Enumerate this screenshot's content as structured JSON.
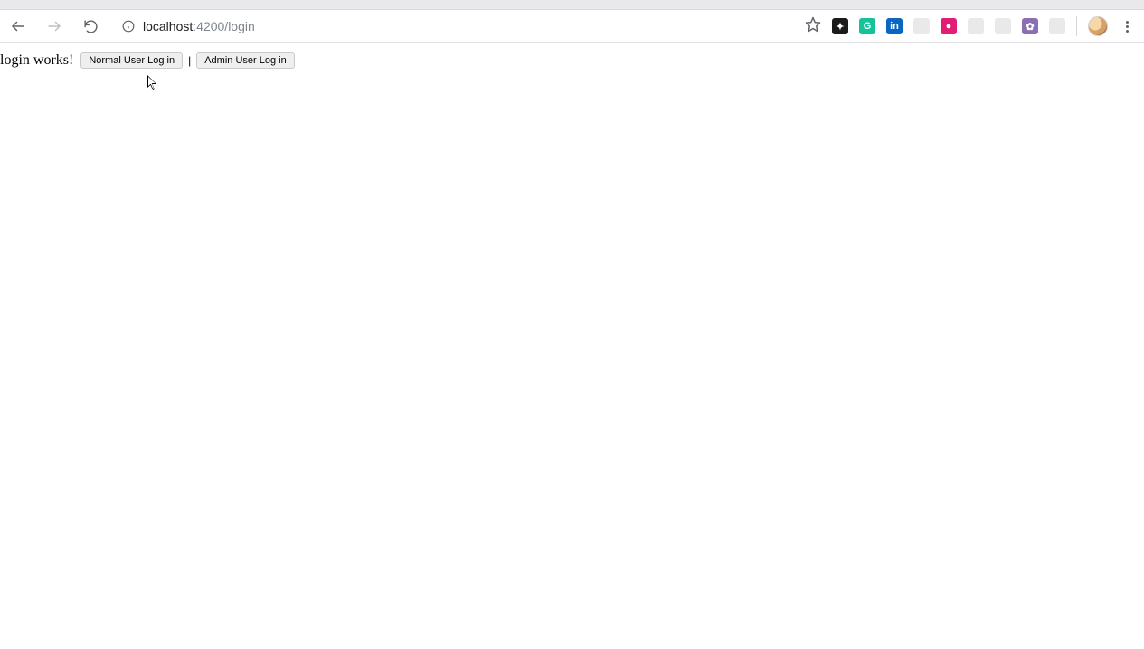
{
  "address": {
    "url_host": "localhost",
    "url_rest": ":4200/login"
  },
  "page": {
    "message": "login works!",
    "normal_btn": "Normal User Log in",
    "separator": "|",
    "admin_btn": "Admin User Log in"
  },
  "ext": [
    {
      "name": "extension-1",
      "bg": "#1b1b1b",
      "glyph": "✦"
    },
    {
      "name": "grammarly",
      "bg": "#15c39a",
      "glyph": "G"
    },
    {
      "name": "linkedin",
      "bg": "#0a66c2",
      "glyph": "in"
    },
    {
      "name": "extension-4",
      "bg": "#bfbfc4",
      "glyph": "",
      "muted": true
    },
    {
      "name": "extension-5",
      "bg": "#e11d74",
      "glyph": "●"
    },
    {
      "name": "extension-6",
      "bg": "#bfbfc4",
      "glyph": "",
      "muted": true
    },
    {
      "name": "extension-7",
      "bg": "#bfbfc4",
      "glyph": "",
      "muted": true
    },
    {
      "name": "extension-8",
      "bg": "#8b6fb3",
      "glyph": "✿",
      "muted": false
    },
    {
      "name": "extension-9",
      "bg": "#bfbfc4",
      "glyph": "",
      "muted": true
    }
  ]
}
